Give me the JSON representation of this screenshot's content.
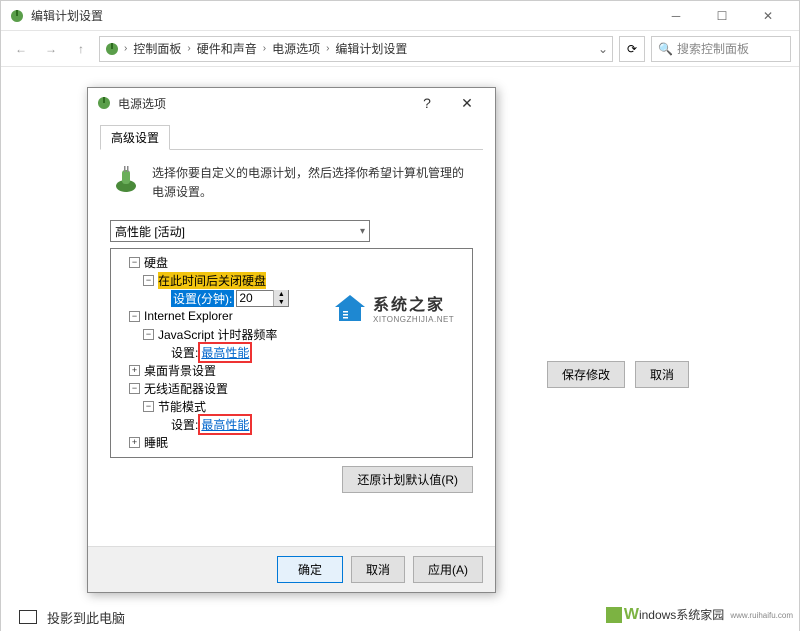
{
  "outer_window": {
    "title": "编辑计划设置",
    "breadcrumb": [
      "控制面板",
      "硬件和声音",
      "电源选项",
      "编辑计划设置"
    ],
    "search_placeholder": "搜索控制面板",
    "save_btn": "保存修改",
    "cancel_btn": "取消"
  },
  "dialog": {
    "title": "电源选项",
    "tab_label": "高级设置",
    "description": "选择你要自定义的电源计划，然后选择你希望计算机管理的电源设置。",
    "plan_selected": "高性能 [活动]",
    "tree": {
      "hard_disk": "硬盘",
      "hd_turnoff": "在此时间后关闭硬盘",
      "hd_setting_label": "设置(分钟):",
      "hd_setting_value": "20",
      "ie": "Internet Explorer",
      "js_timer": "JavaScript 计时器频率",
      "js_setting_label": "设置:",
      "js_setting_value": "最高性能",
      "desktop_bg": "桌面背景设置",
      "wireless": "无线适配器设置",
      "power_saving": "节能模式",
      "ps_setting_label": "设置:",
      "ps_setting_value": "最高性能",
      "sleep": "睡眠"
    },
    "restore_btn": "还原计划默认值(R)",
    "ok_btn": "确定",
    "cancel_btn": "取消",
    "apply_btn": "应用(A)"
  },
  "taskbar": {
    "project_label": "投影到此电脑"
  },
  "watermark1": {
    "main": "系统之家",
    "sub": "XITONGZHIJIA.NET"
  },
  "watermark2": {
    "brand_initial": "W",
    "brand_rest": "indows系统家园",
    "url": "www.ruihaifu.com"
  }
}
